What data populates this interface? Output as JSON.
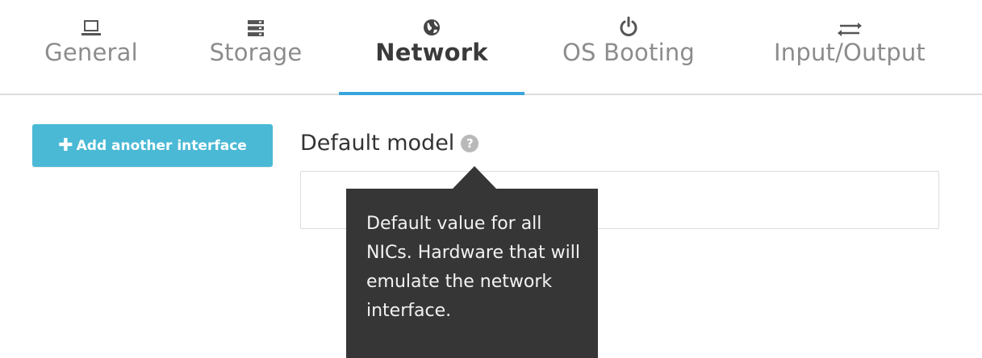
{
  "tabs": [
    {
      "id": "general",
      "label": "General",
      "icon": "laptop-icon",
      "active": false
    },
    {
      "id": "storage",
      "label": "Storage",
      "icon": "storage-icon",
      "active": false
    },
    {
      "id": "network",
      "label": "Network",
      "icon": "globe-icon",
      "active": true
    },
    {
      "id": "os-booting",
      "label": "OS Booting",
      "icon": "power-icon",
      "active": false
    },
    {
      "id": "input-output",
      "label": "Input/Output",
      "icon": "exchange-icon",
      "active": false
    }
  ],
  "network": {
    "add_button_label": "Add another interface",
    "add_button_icon": "plus-icon",
    "default_model_label": "Default model",
    "default_model_value": "",
    "help_icon": "question-circle-icon",
    "tooltip_text": "Default value for all NICs. Hardware that will emulate the network interface."
  },
  "colors": {
    "accent": "#39a5dc",
    "button": "#4ab9d5",
    "tooltip_bg": "#363636"
  }
}
